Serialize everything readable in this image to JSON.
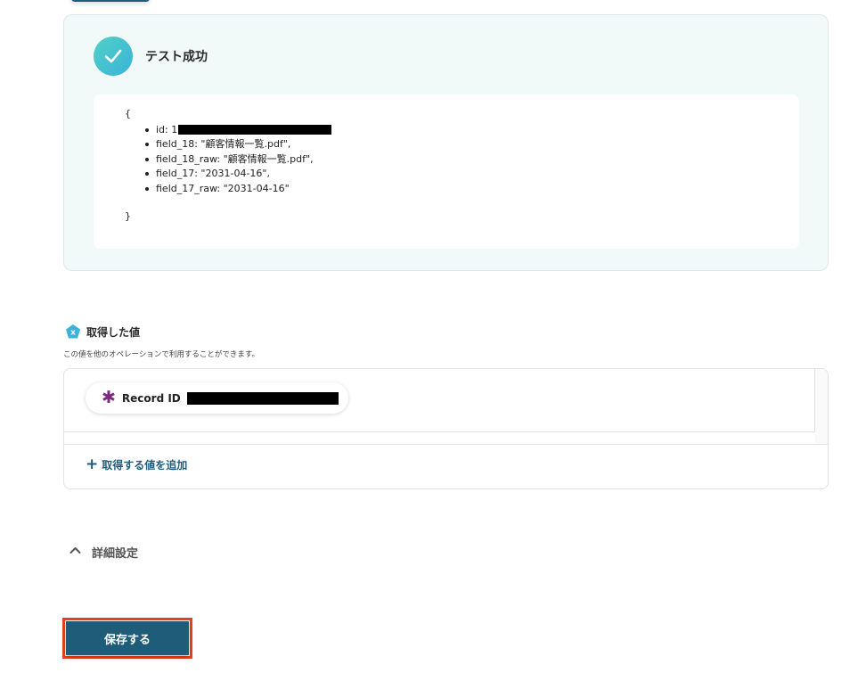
{
  "test_result": {
    "status_label": "テスト成功",
    "json_open": "{",
    "json_close": "}",
    "fields": [
      {
        "text": "id: 1",
        "redacted": true
      },
      {
        "text": "field_18: \"顧客情報一覧.pdf\",",
        "redacted": false
      },
      {
        "text": "field_18_raw: \"顧客情報一覧.pdf\",",
        "redacted": false
      },
      {
        "text": "field_17: \"2031-04-16\",",
        "redacted": false
      },
      {
        "text": "field_17_raw: \"2031-04-16\"",
        "redacted": false
      }
    ]
  },
  "acquired_values": {
    "title": "取得した値",
    "badge": "x",
    "description": "この値を他のオペレーションで利用することができます。",
    "chips": [
      {
        "label": "Record ID",
        "icon": "asterisk-icon",
        "redacted": true
      }
    ],
    "add_label": "取得する値を追加"
  },
  "advanced_settings": {
    "label": "詳細設定"
  },
  "save_button": {
    "label": "保存する"
  },
  "colors": {
    "primary": "#1f5c7a",
    "success_gradient_start": "#4fd1c5",
    "success_gradient_end": "#3bb3d9",
    "panel_bg": "#f2f9f9",
    "highlight": "#e8401c",
    "chip_icon": "#7b2a7e"
  }
}
